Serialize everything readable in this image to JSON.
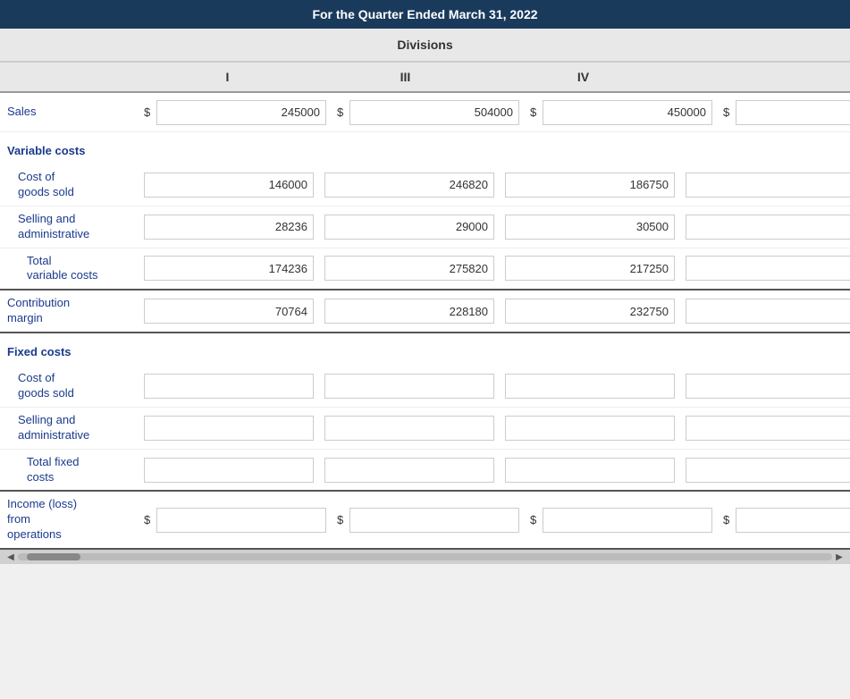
{
  "header": {
    "title": "For the Quarter Ended March 31, 2022",
    "divisions_label": "Divisions"
  },
  "columns": {
    "I": "I",
    "III": "III",
    "IV": "IV",
    "total": ""
  },
  "rows": {
    "sales_label": "Sales",
    "sales_I": "245000",
    "sales_III": "504000",
    "sales_IV": "450000",
    "sales_total": "",
    "variable_costs_label": "Variable costs",
    "cost_goods_sold_label": "Cost of\ngoods sold",
    "cost_goods_I": "146000",
    "cost_goods_III": "246820",
    "cost_goods_IV": "186750",
    "cost_goods_total": "",
    "selling_admin_label": "Selling and\nadministrative",
    "selling_I": "28236",
    "selling_III": "29000",
    "selling_IV": "30500",
    "selling_total": "",
    "total_variable_label": "Total\nvariable costs",
    "total_var_I": "174236",
    "total_var_III": "275820",
    "total_var_IV": "217250",
    "total_var_total": "",
    "contribution_margin_label": "Contribution\nmargin",
    "contrib_I": "70764",
    "contrib_III": "228180",
    "contrib_IV": "232750",
    "contrib_total": "",
    "fixed_costs_label": "Fixed costs",
    "fixed_cost_goods_label": "Cost of\ngoods sold",
    "fixed_cost_goods_I": "",
    "fixed_cost_goods_III": "",
    "fixed_cost_goods_IV": "",
    "fixed_cost_goods_total": "",
    "fixed_selling_label": "Selling and\nadministrative",
    "fixed_selling_I": "",
    "fixed_selling_III": "",
    "fixed_selling_IV": "",
    "fixed_selling_total": "",
    "total_fixed_label": "Total fixed\ncosts",
    "total_fixed_I": "",
    "total_fixed_III": "",
    "total_fixed_IV": "",
    "total_fixed_total": "",
    "income_loss_label": "Income (loss)\nfrom\noperations",
    "income_I": "",
    "income_III": "",
    "income_IV": "",
    "income_total": ""
  }
}
